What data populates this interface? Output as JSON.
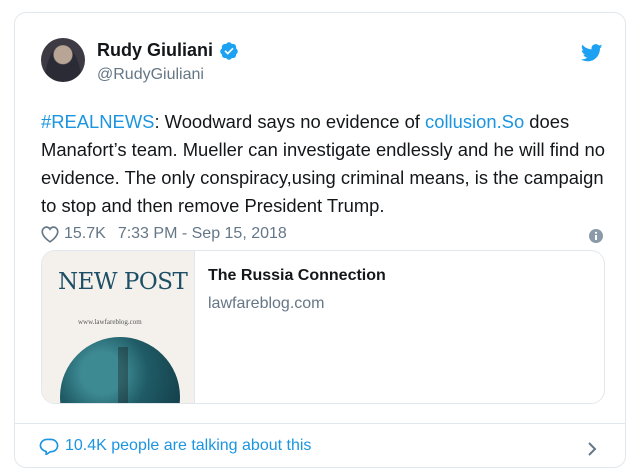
{
  "author": {
    "name": "Rudy Giuliani",
    "handle": "@RudyGiuliani"
  },
  "tweet": {
    "hashtag": "#REALNEWS",
    "text_1": ": Woodward says no evidence of ",
    "link_text": "collusion.So",
    "text_2": " does Manafort’s team. Mueller can investigate endlessly and he will find no evidence. The only conspiracy,using criminal means, is the campaign to stop and then remove President Trump."
  },
  "meta": {
    "likes": "15.7K",
    "time": "7:33 PM - Sep 15, 2018"
  },
  "card": {
    "thumb_title": "NEW POST",
    "thumb_url": "www.lawfareblog.com",
    "title": "The Russia Connection",
    "domain": "lawfareblog.com"
  },
  "footer": {
    "talking": "10.4K people are talking about this"
  },
  "colors": {
    "link": "#1b95e0",
    "secondary": "#657786",
    "border": "#e1e8ed"
  },
  "icons": [
    "verified-badge-icon",
    "twitter-bird-icon",
    "heart-icon",
    "info-icon",
    "speech-bubble-icon",
    "chevron-right-icon"
  ]
}
